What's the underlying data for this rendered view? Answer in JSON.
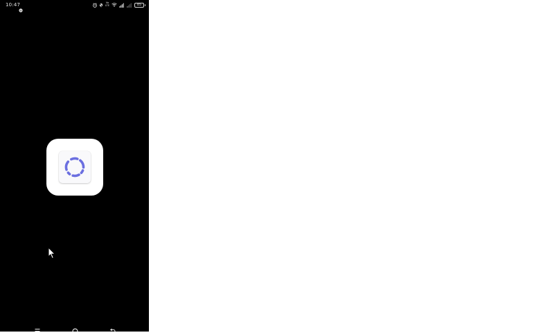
{
  "status_bar": {
    "time": "10:47",
    "left_icons": [
      "emoji-notification-icon"
    ],
    "right_icons": [
      "alarm-icon",
      "silent-icon",
      "volte-icon",
      "wifi-icon",
      "signal-icon",
      "signal-weak-icon",
      "battery-icon"
    ],
    "network_label_top": "Vo",
    "network_label_bottom": "LTE",
    "battery_level": "85"
  },
  "launch": {
    "app_icon": "loading-spinner-app-icon",
    "spinner_color": "#6b6fe0",
    "tile_color": "#ffffff",
    "screen_color": "#000000"
  },
  "nav_bar": {
    "buttons": [
      "menu-icon",
      "home-icon",
      "back-icon"
    ]
  }
}
